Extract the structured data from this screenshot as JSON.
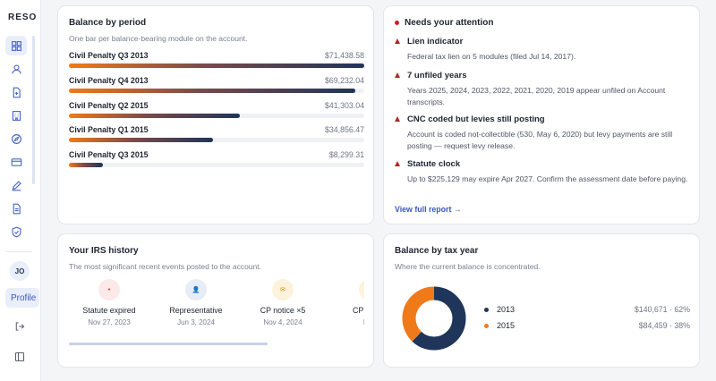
{
  "app": {
    "brand": "RESO"
  },
  "sidebar": {
    "icons": [
      "dashboard-icon",
      "user-icon",
      "document-icon",
      "building-icon",
      "compass-icon",
      "credit-card-icon",
      "pen-icon",
      "file-text-icon",
      "shield-icon"
    ],
    "avatar_initials": "JO",
    "profile_label": "Profile"
  },
  "balance_by_period": {
    "title": "Balance by period",
    "subtitle": "One bar per balance-bearing module on the account.",
    "rows": [
      {
        "name": "Civil Penalty Q3 2013",
        "value": "$71,438.58",
        "fraction": 1.0
      },
      {
        "name": "Civil Penalty Q4 2013",
        "value": "$69,232.04",
        "fraction": 0.969
      },
      {
        "name": "Civil Penalty Q2 2015",
        "value": "$41,303.04",
        "fraction": 0.578
      },
      {
        "name": "Civil Penalty Q1 2015",
        "value": "$34,856.47",
        "fraction": 0.488
      },
      {
        "name": "Civil Penalty Q3 2015",
        "value": "$8,299.31",
        "fraction": 0.116
      }
    ]
  },
  "attention": {
    "title": "Needs your attention",
    "items": [
      {
        "title": "Lien indicator",
        "desc": "Federal tax lien on 5 modules (filed Jul 14, 2017)."
      },
      {
        "title": "7 unfiled years",
        "desc": "Years 2025, 2024, 2023, 2022, 2021, 2020, 2019 appear unfiled on Account transcripts."
      },
      {
        "title": "CNC coded but levies still posting",
        "desc": "Account is coded not-collectible (530, May 6, 2020) but levy payments are still posting — request levy release."
      },
      {
        "title": "Statute clock",
        "desc": "Up to $225,129 may expire Apr 2027. Confirm the assessment date before paying."
      }
    ],
    "link": "View full report →"
  },
  "irs_history": {
    "title": "Your IRS history",
    "subtitle": "The most significant recent events posted to the account.",
    "events": [
      {
        "label": "Statute expired",
        "date": "Nov 27, 2023",
        "icon": "dot-icon",
        "glyph": "•",
        "bg": "#fde9e9",
        "fg": "#c62828"
      },
      {
        "label": "Representative",
        "date": "Jun 3, 2024",
        "icon": "person-icon",
        "glyph": "👤",
        "bg": "#e7ecf7",
        "fg": "#3a58c0"
      },
      {
        "label": "CP notice ×5",
        "date": "Nov 4, 2024",
        "icon": "mail-icon",
        "glyph": "✉",
        "bg": "#fdf3dc",
        "fg": "#c98a12"
      },
      {
        "label": "CP notice",
        "date": "Nov",
        "icon": "mail-icon",
        "glyph": "✉",
        "bg": "#fdf3dc",
        "fg": "#c98a12"
      }
    ]
  },
  "tax_year": {
    "title": "Balance by tax year",
    "subtitle": "Where the current balance is concentrated.",
    "rows": [
      {
        "year": "2013",
        "value": "$140,671 · 62%",
        "share": 62,
        "color": "#1f3559"
      },
      {
        "year": "2015",
        "value": "$84,459 · 38%",
        "share": 38,
        "color": "#f07a1a"
      }
    ]
  }
}
